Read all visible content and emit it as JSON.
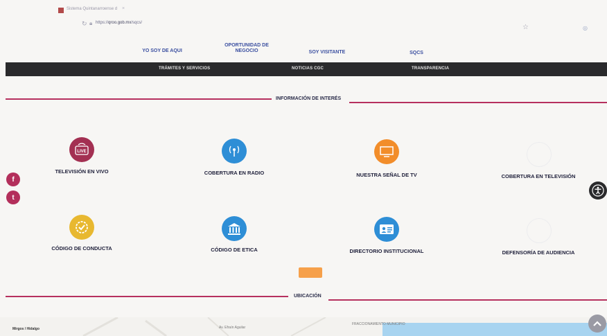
{
  "browser": {
    "tab_title": "Sistema Quintanarroense d",
    "tab_close": "×",
    "url_prefix": "https://",
    "url_host": "qroo.gob.mx",
    "url_path": "/sqcs/"
  },
  "top_menu": [
    {
      "line1": "YO SOY DE AQUI",
      "line2": ""
    },
    {
      "line1": "OPORTUNIDAD DE",
      "line2": "NEGOCIO"
    },
    {
      "line1": "SOY VISITANTE",
      "line2": ""
    },
    {
      "line1": "SQCS",
      "line2": ""
    }
  ],
  "dark_menu": [
    "TRÁMITES Y SERVICIOS",
    "NOTICIAS CGC",
    "TRANSPARENCIA"
  ],
  "sections": {
    "info_title": "INFORMACIÓN DE INTERÉS",
    "location_title": "UBICACIÓN"
  },
  "tiles": [
    {
      "label": "TELEVISIÓN EN VIVO",
      "icon": "live-tv-icon",
      "color": "#a33052",
      "glyph": "LIVE"
    },
    {
      "label": "COBERTURA EN RADIO",
      "icon": "radio-antenna-icon",
      "color": "#2e8ed6",
      "glyph": "((•))"
    },
    {
      "label": "NUESTRA SEÑAL DE TV",
      "icon": "tv-screen-icon",
      "color": "#f28d2a",
      "glyph": "▭"
    },
    {
      "label": "COBERTURA EN TELEVISIÓN",
      "icon": "tv-coverage-icon",
      "color": "",
      "glyph": ""
    },
    {
      "label": "CÓDIGO DE CONDUCTA",
      "icon": "badge-check-icon",
      "color": "#e8b830",
      "glyph": "✓"
    },
    {
      "label": "CÓDIGO DE ETICA",
      "icon": "building-icon",
      "color": "#2e8ed6",
      "glyph": "🏛"
    },
    {
      "label": "DIRECTORIO INSTITUCIONAL",
      "icon": "id-card-icon",
      "color": "#2e8ed6",
      "glyph": "▤"
    },
    {
      "label": "DEFENSORÍA DE AUDIENCIA",
      "icon": "audience-icon",
      "color": "",
      "glyph": ""
    }
  ],
  "social": {
    "facebook": "f",
    "twitter": "t"
  },
  "map": {
    "place": "Mirgos / Hidalgo",
    "street1": "Av. Efraín Aguilar",
    "street2": "FRACCIONAMIENTO MUNICIPIO"
  }
}
